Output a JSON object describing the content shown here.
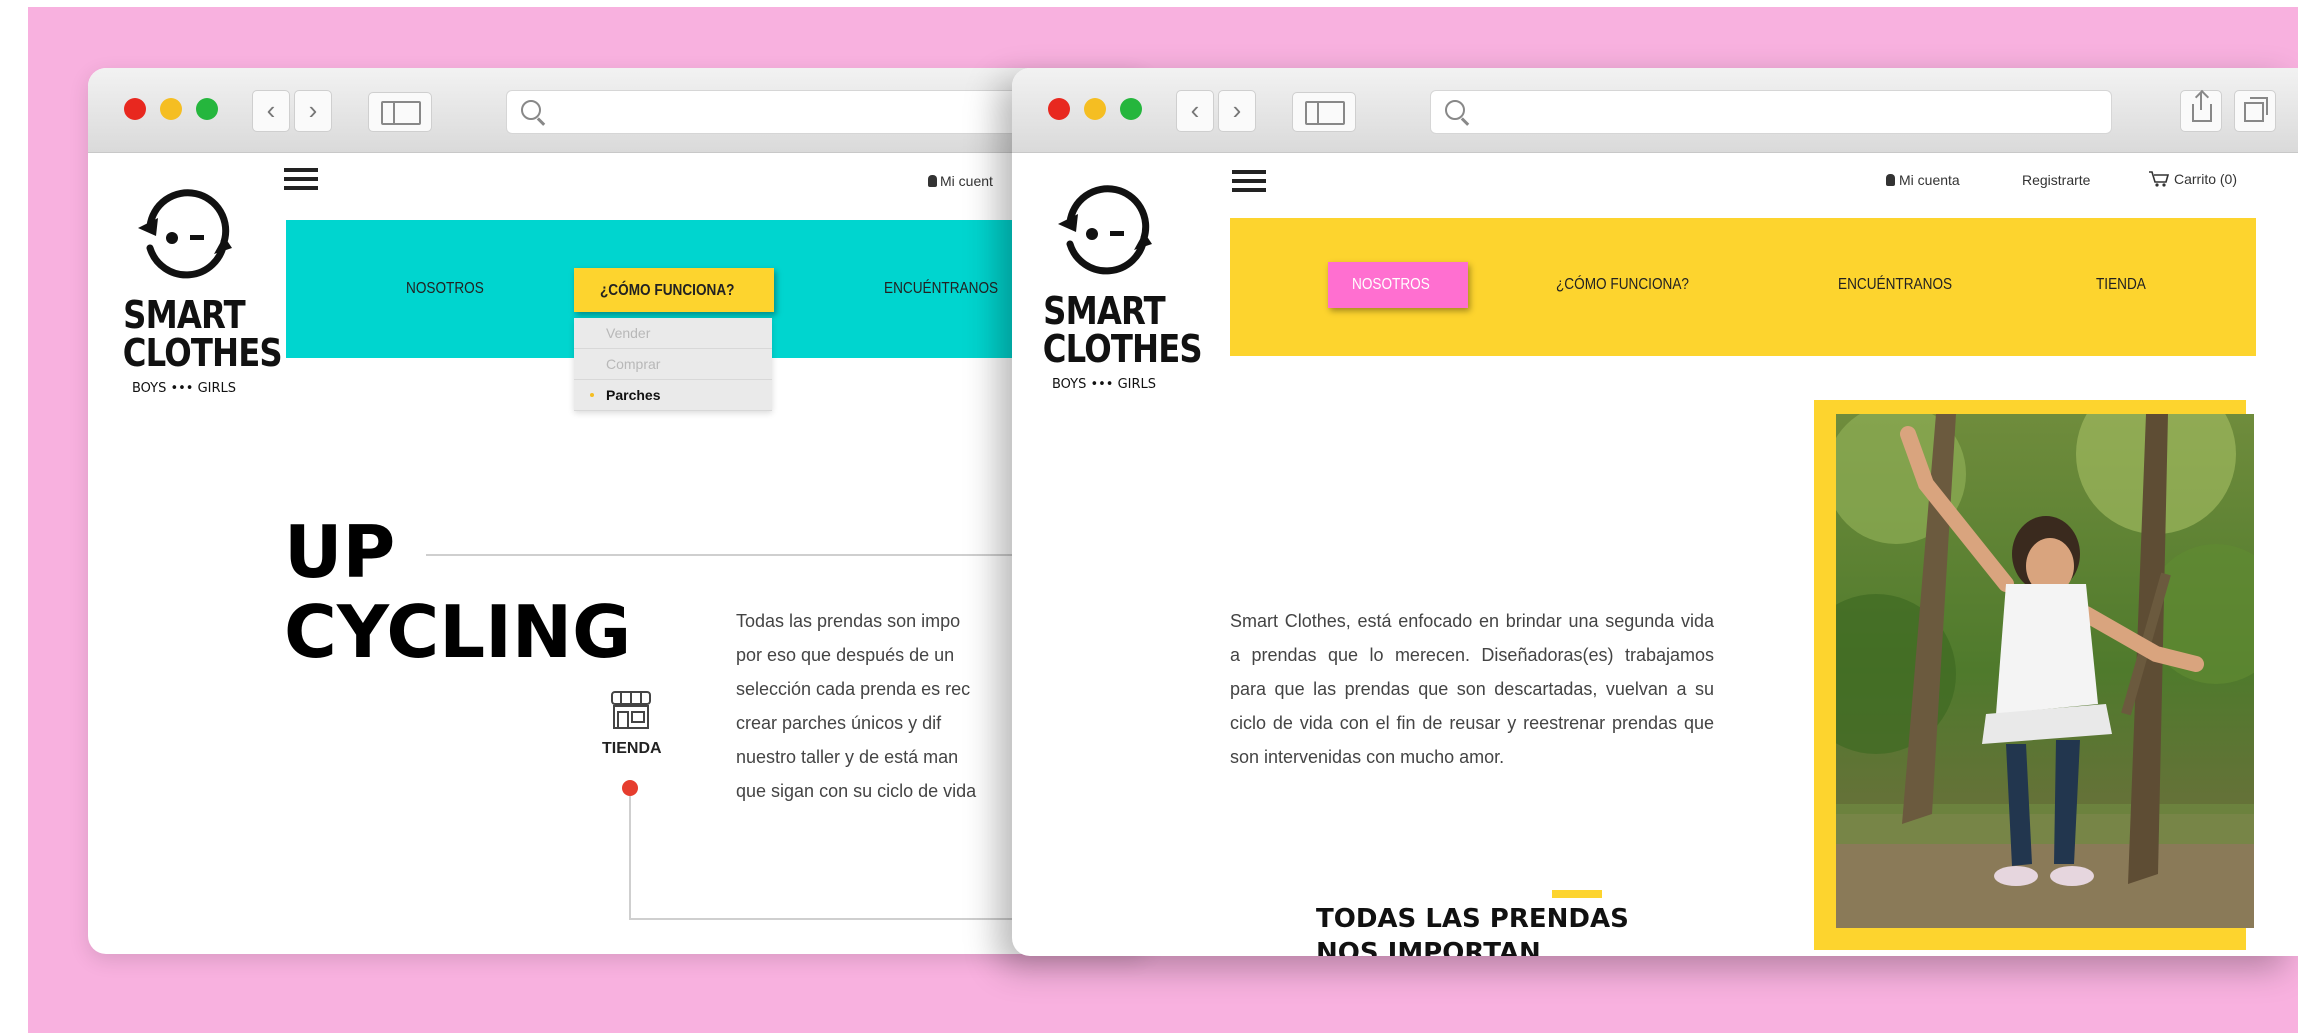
{
  "colors": {
    "background": "#f8b1df",
    "teal": "#00d5cf",
    "yellow": "#fdd42e",
    "pink": "#ff6fd0",
    "red_dot": "#e63d2e"
  },
  "left_window": {
    "account_text": "Mi cuent",
    "logo": {
      "line1": "SMART",
      "line2": "CLOTHES",
      "line3": "BOYS ••• GIRLS"
    },
    "menu": {
      "item1": "NOSOTROS",
      "item2_active": "¿CÓMO FUNCIONA?",
      "item3": "ENCUÉNTRANOS",
      "dropdown": [
        "Vender",
        "Comprar",
        "Parches"
      ]
    },
    "hero": {
      "line1": "UP",
      "line2": "CYCLING"
    },
    "store_icon_label": "TIENDA",
    "paragraph_lines": [
      "Todas las prendas son impo",
      "por eso que después de un",
      "selección cada prenda es rec",
      "crear parches únicos y dif",
      "nuestro taller y de está man",
      "que sigan con su ciclo de vida"
    ]
  },
  "right_window": {
    "header_links": {
      "account": "Mi cuenta",
      "register": "Registrarte",
      "cart": "Carrito (0)"
    },
    "logo": {
      "line1": "SMART",
      "line2": "CLOTHES",
      "line3": "BOYS ••• GIRLS"
    },
    "menu": {
      "item1_active": "NOSOTROS",
      "item2": "¿CÓMO FUNCIONA?",
      "item3": "ENCUÉNTRANOS",
      "item4": "TIENDA"
    },
    "paragraph": "Smart Clothes, está enfocado en brindar una segunda vida a prendas que lo merecen. Diseñadoras(es) trabajamos para que las prendas que son descartadas, vuelvan a su ciclo de vida con el fin de reusar y reestrenar prendas que son intervenidas con mucho amor.",
    "headline": {
      "line1": "TODAS LAS PRENDAS",
      "line2": "NOS IMPORTAN"
    }
  }
}
